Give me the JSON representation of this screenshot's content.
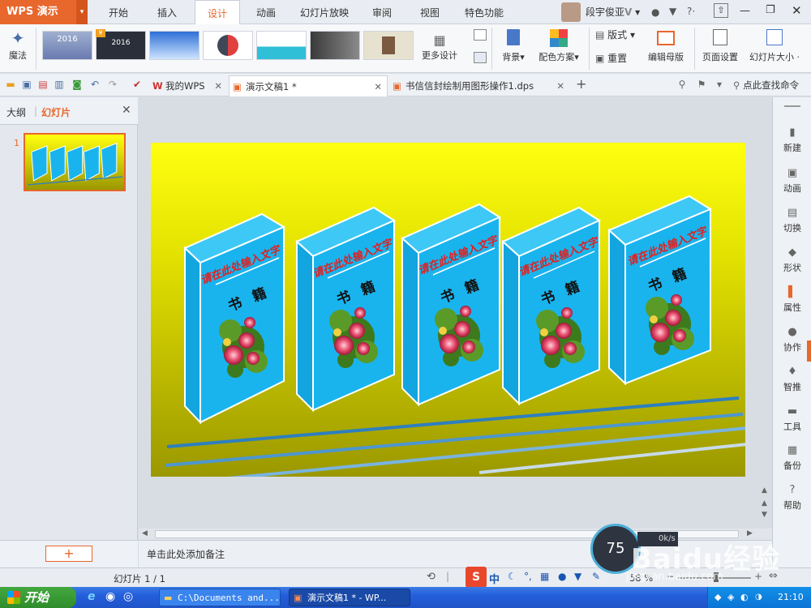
{
  "app": {
    "logo": "WPS 演示",
    "logo_dropdown": "▾"
  },
  "tabs": [
    {
      "label": "开始"
    },
    {
      "label": "插入"
    },
    {
      "label": "设计"
    },
    {
      "label": "动画"
    },
    {
      "label": "幻灯片放映"
    },
    {
      "label": "审阅"
    },
    {
      "label": "视图"
    },
    {
      "label": "特色功能"
    }
  ],
  "user": {
    "name": "段宇俊亚",
    "badge": "V"
  },
  "ribbon": {
    "magic": "魔法",
    "thumb_labels": [
      "2016",
      "2016"
    ],
    "more_design": "更多设计",
    "background": "背景",
    "color_scheme": "配色方案",
    "layout": "版式",
    "reset": "重置",
    "edit_master": "编辑母版",
    "page_setup": "页面设置",
    "slide_size": "幻灯片大小"
  },
  "doc_tabs": [
    {
      "label": "我的WPS"
    },
    {
      "label": "演示文稿1 *"
    },
    {
      "label": "书信信封绘制用图形操作1.dps"
    }
  ],
  "search_label": "点此查找命令",
  "left_panel": {
    "tab_outline": "大纲",
    "tab_slides": "幻灯片",
    "slide_number": "1",
    "add_button": "+"
  },
  "slide": {
    "book_title": "请在此处输入文字",
    "book_label_1": "书",
    "book_label_2": "籍"
  },
  "right_sidebar": [
    "新建",
    "动画",
    "切换",
    "形状",
    "属性",
    "协作",
    "智推",
    "工具",
    "备份",
    "帮助"
  ],
  "notes_placeholder": "单击此处添加备注",
  "status": {
    "slide_counter": "幻灯片 1 / 1",
    "zoom": "58 %",
    "ime": "中"
  },
  "overlay": {
    "score": "75",
    "speed": "0k/s",
    "watermark": "Baidu经验",
    "watermark_url": "jingyan.baidu.com"
  },
  "taskbar": {
    "start": "开始",
    "tasks": [
      "C:\\Documents and...",
      "演示文稿1 * - WP..."
    ],
    "time": "21:10"
  },
  "colors": {
    "accent": "#e8672c",
    "book_face": "#19b4ee",
    "taskbar": "#245edb"
  }
}
